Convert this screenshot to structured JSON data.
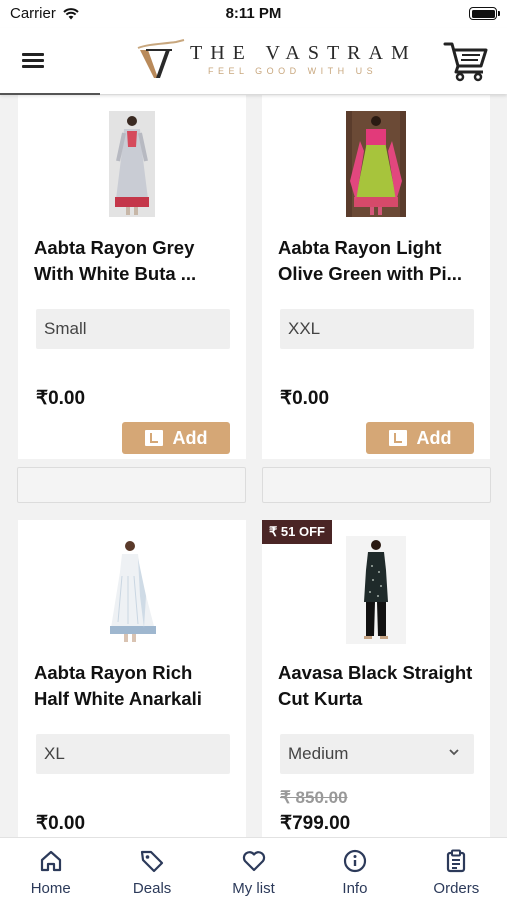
{
  "status_bar": {
    "carrier": "Carrier",
    "time": "8:11 PM"
  },
  "header": {
    "brand": "THE VASTRAM",
    "tagline": "FEEL GOOD WITH US"
  },
  "products": [
    {
      "name": "Aabta Rayon Grey With White Buta ...",
      "size": "Small",
      "price": "₹0.00",
      "add_label": "Add"
    },
    {
      "name": "Aabta Rayon Light Olive Green with Pi...",
      "size": "XXL",
      "price": "₹0.00",
      "add_label": "Add"
    },
    {
      "name": "Aabta Rayon Rich Half White Anarkali",
      "size": "XL",
      "price": "₹0.00"
    },
    {
      "name": "Aavasa Black Straight Cut Kurta",
      "size": "Medium",
      "original_price": "₹ 850.00",
      "price": "₹799.00",
      "badge": "₹ 51 OFF"
    }
  ],
  "tabs": [
    {
      "label": "Home",
      "icon": "home-icon"
    },
    {
      "label": "Deals",
      "icon": "tag-icon"
    },
    {
      "label": "My list",
      "icon": "heart-icon"
    },
    {
      "label": "Info",
      "icon": "info-icon"
    },
    {
      "label": "Orders",
      "icon": "clipboard-icon"
    }
  ],
  "colors": {
    "accent": "#d5a776",
    "badge": "#4a2525",
    "tab_text": "#2c3a5a"
  }
}
